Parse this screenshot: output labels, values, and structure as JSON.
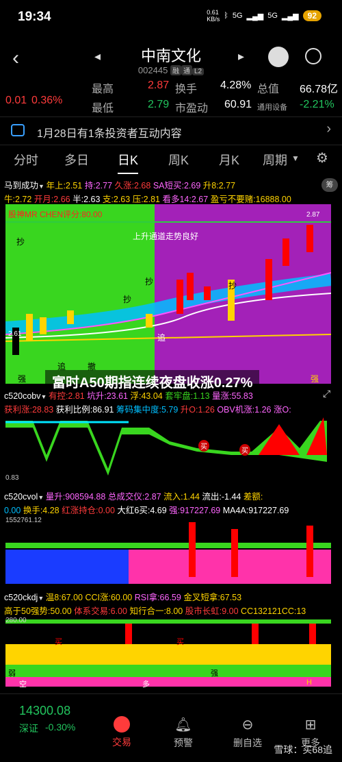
{
  "status": {
    "time": "19:34",
    "speed": "0.61\nKB/s",
    "signal1": "5G",
    "signal2": "5G",
    "battery": "92"
  },
  "header": {
    "name": "中南文化",
    "code": "002445",
    "tags": [
      "融",
      "通",
      "L2"
    ]
  },
  "quote": {
    "change": "0.01",
    "pct": "0.36%",
    "high_label": "最高",
    "high": "2.87",
    "low_label": "最低",
    "low": "2.79",
    "turnover_label": "换手",
    "turnover": "4.28%",
    "pe_label": "市盈动",
    "pe": "60.91",
    "mktcap_label": "总值",
    "mktcap": "66.78亿",
    "board_label": "通用设备",
    "board_pct": "-2.21%"
  },
  "notice": {
    "text": "1月28日有1条投资者互动内容"
  },
  "tabs": [
    "分时",
    "多日",
    "日K",
    "周K",
    "月K",
    "周期"
  ],
  "indicator": {
    "name": "马到成功",
    "r1": [
      "年上:2.51",
      "持:2.77",
      "久涨:2.68",
      "SA短买:2.69",
      "升8:2.77"
    ],
    "r2": [
      "牛:2.72",
      "开月:2.66",
      "半:2.63",
      "支:2.63",
      "压:2.81",
      "看多14:2.67",
      "盈亏不要赌:16888.00"
    ],
    "hint": "筹"
  },
  "main_chart": {
    "title_text": "股神MR CHEN评分:80.00",
    "trend_text": "上升通道走势良好",
    "top_value": "2.87",
    "bottom_value": "2.61",
    "chao": "抄",
    "zhui": "追",
    "che": "撤",
    "qiang": "强"
  },
  "headline": "富时A50期指连续夜盘收涨0.27%",
  "cobv": {
    "name": "c520cobv",
    "r1": [
      "有控:2.81",
      "坑升:23.61",
      "浮:43.04",
      "套牢盘:1.13",
      "量涨:55.83"
    ],
    "r2": [
      "获利涨:28.83",
      "获利比例:86.91",
      "筹码集中度:5.79",
      "升O:1.26",
      "OBV机涨:1.26",
      "涨O:"
    ],
    "low": "0.83",
    "buy": "买"
  },
  "cvol": {
    "name": "c520cvol",
    "r1": [
      "量升:908594.88",
      "总成交仪:2.87",
      "流入:1.44",
      "流出:-1.44",
      "差额:"
    ],
    "r2": [
      "0.00",
      "换手:4.28",
      "红涨持仓:0.00",
      "大红6买:4.69",
      "强:917227.69",
      "MA4A:917227.69"
    ],
    "scale": "1552761.12"
  },
  "ckdj": {
    "name": "c520ckdj",
    "r1": [
      "温8:67.00",
      "CCI涨:60.00",
      "RSI拿:66.59",
      "金叉短拿:67.53"
    ],
    "r2": [
      "高于50强势:50.00",
      "体系交易:6.00",
      "知行合一:8.00",
      "股市长虹:9.00",
      "CC132121CC:13"
    ],
    "scale": "280.00",
    "buy": "买",
    "weak": "弱",
    "strong": "强",
    "duo": "多",
    "kong": "空",
    "h": "H"
  },
  "bottom": {
    "index": "14300.08",
    "index_name": "深证",
    "index_pct": "-0.30%",
    "nav": [
      "交易",
      "预警",
      "删自选",
      "更多"
    ],
    "watermark": "雪球：买68追"
  },
  "colors": {
    "red": "#ff3b3b",
    "green": "#22c55e",
    "magenta": "#b026c4",
    "lime": "#39d61f"
  }
}
